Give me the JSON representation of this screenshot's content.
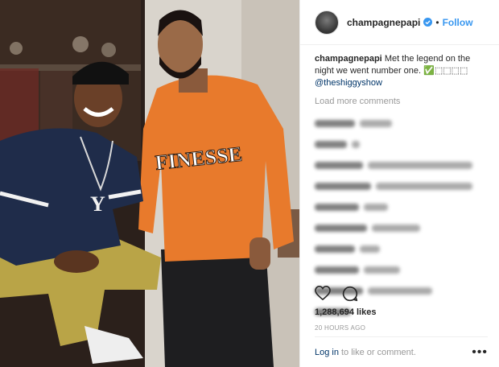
{
  "post": {
    "username": "champagnepapi",
    "follow_label": "Follow",
    "separator": "•",
    "caption_text": "Met the legend on the night we went number one. ✅⬚⬚⬚⬚",
    "caption_mention": "@theshiggyshow",
    "load_more": "Load more comments",
    "likes": "1,288,694 likes",
    "time_ago": "20 HOURS AGO",
    "login_label": "Log in",
    "login_rest": "to like or comment.",
    "more_label": "•••"
  },
  "photo": {
    "sweatshirt_text": "FINESSE"
  },
  "colors": {
    "link": "#3897f0",
    "verified": "#3897f0",
    "sweatshirt": "#e87a2c"
  }
}
